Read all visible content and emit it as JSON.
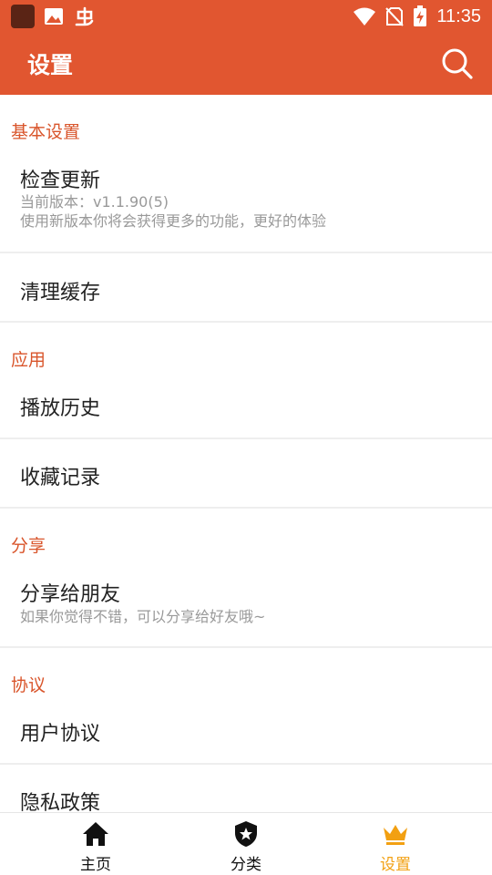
{
  "status_bar": {
    "time": "11:35"
  },
  "app_bar": {
    "title": "设置"
  },
  "sections": [
    {
      "header": "基本设置",
      "items": [
        {
          "title": "检查更新",
          "subtitle_1": "当前版本：v1.1.90(5)",
          "subtitle_2": "使用新版本你将会获得更多的功能，更好的体验"
        },
        {
          "title": "清理缓存"
        }
      ]
    },
    {
      "header": "应用",
      "items": [
        {
          "title": "播放历史"
        },
        {
          "title": "收藏记录"
        }
      ]
    },
    {
      "header": "分享",
      "items": [
        {
          "title": "分享给朋友",
          "subtitle_1": "如果你觉得不错，可以分享给好友哦~"
        }
      ]
    },
    {
      "header": "协议",
      "items": [
        {
          "title": "用户协议"
        },
        {
          "title": "隐私政策"
        }
      ]
    }
  ],
  "bottom_nav": {
    "items": [
      {
        "label": "主页",
        "icon": "home-icon"
      },
      {
        "label": "分类",
        "icon": "shield-star-icon"
      },
      {
        "label": "设置",
        "icon": "crown-icon"
      }
    ],
    "active_index": 2
  },
  "colors": {
    "primary": "#E15630",
    "accent_text": "#D9552B",
    "active_nav": "#F2A012"
  }
}
